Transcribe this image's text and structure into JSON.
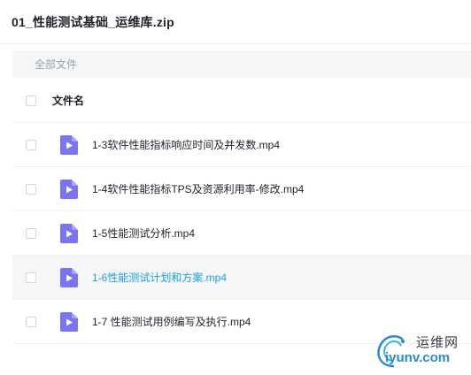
{
  "header": {
    "title": "01_性能测试基础_运维库.zip"
  },
  "breadcrumb": {
    "label": "全部文件"
  },
  "table": {
    "column_name": "文件名"
  },
  "files": [
    {
      "name": "1-3软件性能指标响应时间及并发数.mp4",
      "hovered": false
    },
    {
      "name": "1-4软件性能指标TPS及资源利用率-修改.mp4",
      "hovered": false
    },
    {
      "name": "1-5性能测试分析.mp4",
      "hovered": false
    },
    {
      "name": "1-6性能测试计划和方案.mp4",
      "hovered": true
    },
    {
      "name": "1-7 性能测试用例编写及执行.mp4",
      "hovered": false
    }
  ],
  "colors": {
    "accent": "#1e9fd8",
    "icon": "#7b74f2",
    "hover_bg": "#f5f6f8"
  },
  "file_icon": "video-file-icon",
  "watermark": {
    "cn": "运维网",
    "en": "iyunv.com"
  }
}
